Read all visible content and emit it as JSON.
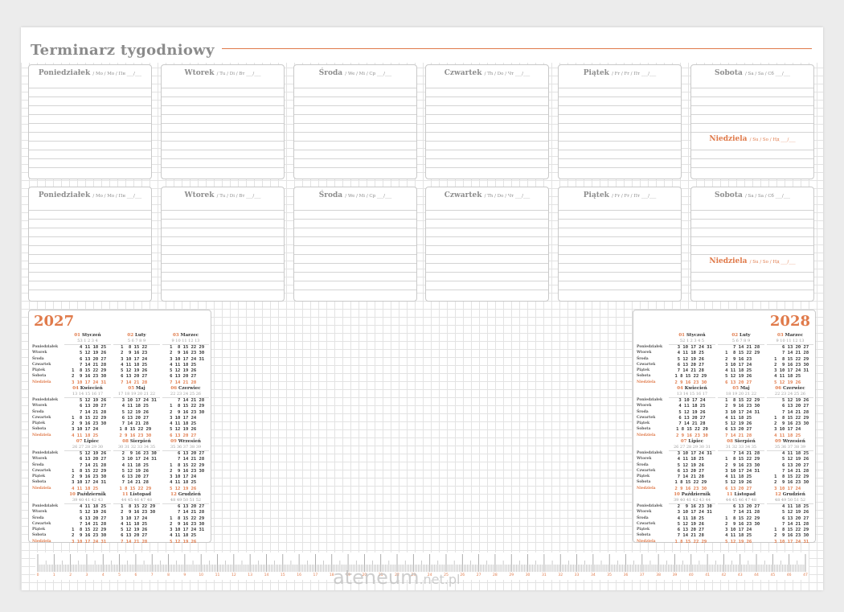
{
  "title": "Terminarz  tygodniowy",
  "colors": {
    "accent": "#e07a4a",
    "grid": "#e3e3e3",
    "text_gray": "#8b8b8b"
  },
  "week_days": [
    {
      "name": "Poniedziałek",
      "sub": "/ Mo / Mo / Пн  ___/___"
    },
    {
      "name": "Wtorek",
      "sub": "/ Tu / Di / Вт  ___/___"
    },
    {
      "name": "Środa",
      "sub": "/ We / Mi / Ср  ___/___"
    },
    {
      "name": "Czwartek",
      "sub": "/ Th / Do / Чт  ___/___"
    },
    {
      "name": "Piątek",
      "sub": "/ Fr / Fr / Пт  ___/___"
    },
    {
      "name": "Sobota",
      "sub": "/ Sa / Sa / Сб  ___/___"
    }
  ],
  "sunday": {
    "name": "Niedziela",
    "sub": "/ Su / So / Нд  ___/___"
  },
  "weekday_labels": [
    "Poniedziałek",
    "Wtorek",
    "Środa",
    "Czwartek",
    "Piątek",
    "Sobota",
    "Niedziela"
  ],
  "calendars": [
    {
      "year": "2027",
      "months": [
        {
          "num": "01",
          "name": "Styczeń",
          "weeks": "53  1  2  3  4",
          "rows": [
            "    4 11 18 25",
            "    5 12 19 26",
            "    6 13 20 27",
            "    7 14 21 28",
            " 1  8 15 22 29",
            " 2  9 16 23 30",
            " 3 10 17 24 31"
          ]
        },
        {
          "num": "02",
          "name": "Luty",
          "weeks": "5  6  7  8  9",
          "rows": [
            " 1  8 15 22   ",
            " 2  9 16 23   ",
            " 3 10 17 24   ",
            " 4 11 18 25   ",
            " 5 12 19 26   ",
            " 6 13 20 27   ",
            " 7 14 21 28   "
          ]
        },
        {
          "num": "03",
          "name": "Marzec",
          "weeks": "9 10 11 12 13",
          "rows": [
            " 1  8 15 22 29",
            " 2  9 16 23 30",
            " 3 10 17 24 31",
            " 4 11 18 25   ",
            " 5 12 19 26   ",
            " 6 13 20 27   ",
            " 7 14 21 28   "
          ]
        },
        {
          "num": "04",
          "name": "Kwiecień",
          "weeks": "13 14 15 16 17",
          "rows": [
            "    5 12 19 26",
            "    6 13 20 27",
            "    7 14 21 28",
            " 1  8 15 22 29",
            " 2  9 16 23 30",
            " 3 10 17 24   ",
            " 4 11 18 25   "
          ]
        },
        {
          "num": "05",
          "name": "Maj",
          "weeks": "17 18 19 20 21 22",
          "rows": [
            "  3 10 17 24 31",
            "  4 11 18 25   ",
            "  5 12 19 26   ",
            "  6 13 20 27   ",
            "  7 14 21 28   ",
            " 1 8 15 22 29  ",
            " 2 9 16 23 30  "
          ]
        },
        {
          "num": "06",
          "name": "Czerwiec",
          "weeks": "22 23 24 25 26",
          "rows": [
            "    7 14 21 28",
            " 1  8 15 22 29",
            " 2  9 16 23 30",
            " 3 10 17 24   ",
            " 4 11 18 25   ",
            " 5 12 19 26   ",
            " 6 13 20 27   "
          ]
        },
        {
          "num": "07",
          "name": "Lipiec",
          "weeks": "26 27 28 29 30",
          "rows": [
            "    5 12 19 26",
            "    6 13 20 27",
            "    7 14 21 28",
            " 1  8 15 22 29",
            " 2  9 16 23 30",
            " 3 10 17 24 31",
            " 4 11 18 25   "
          ]
        },
        {
          "num": "08",
          "name": "Sierpień",
          "weeks": "30 31 32 33 34 35",
          "rows": [
            "  2  9 16 23 30",
            "  3 10 17 24 31",
            "  4 11 18 25   ",
            "  5 12 19 26   ",
            "  6 13 20 27   ",
            "  7 14 21 28   ",
            " 1 8 15 22 29  "
          ]
        },
        {
          "num": "09",
          "name": "Wrzesień",
          "weeks": "35 36 37 38 39",
          "rows": [
            "    6 13 20 27",
            "    7 14 21 28",
            " 1  8 15 22 29",
            " 2  9 16 23 30",
            " 3 10 17 24   ",
            " 4 11 18 25   ",
            " 5 12 19 26   "
          ]
        },
        {
          "num": "10",
          "name": "Październik",
          "weeks": "39 40 41 42 43",
          "rows": [
            "    4 11 18 25",
            "    5 12 19 26",
            "    6 13 20 27",
            "    7 14 21 28",
            " 1  8 15 22 29",
            " 2  9 16 23 30",
            " 3 10 17 24 31"
          ]
        },
        {
          "num": "11",
          "name": "Listopad",
          "weeks": "44 45 46 47 48",
          "rows": [
            " 1  8 15 22 29",
            " 2  9 16 23 30",
            " 3 10 17 24   ",
            " 4 11 18 25   ",
            " 5 12 19 26   ",
            " 6 13 20 27   ",
            " 7 14 21 28   "
          ]
        },
        {
          "num": "12",
          "name": "Grudzień",
          "weeks": "48 49 50 51 52",
          "rows": [
            "    6 13 20 27",
            "    7 14 21 28",
            " 1  8 15 22 29",
            " 2  9 16 23 30",
            " 3 10 17 24 31",
            " 4 11 18 25   ",
            " 5 12 19 26   "
          ]
        }
      ]
    },
    {
      "year": "2028",
      "months": [
        {
          "num": "01",
          "name": "Styczeń",
          "weeks": "52  1  2  3  4  5",
          "rows": [
            "  3 10 17 24 31",
            "  4 11 18 25   ",
            "  5 12 19 26   ",
            "  6 13 20 27   ",
            "  7 14 21 28   ",
            " 1 8 15 22 29  ",
            " 2 9 16 23 30  "
          ]
        },
        {
          "num": "02",
          "name": "Luty",
          "weeks": "5  6  7  8  9",
          "rows": [
            "    7 14 21 28",
            " 1  8 15 22 29",
            " 2  9 16 23   ",
            " 3 10 17 24   ",
            " 4 11 18 25   ",
            " 5 12 19 26   ",
            " 6 13 20 27   "
          ]
        },
        {
          "num": "03",
          "name": "Marzec",
          "weeks": "9 10 11 12 13",
          "rows": [
            "    6 13 20 27",
            "    7 14 21 28",
            " 1  8 15 22 29",
            " 2  9 16 23 30",
            " 3 10 17 24 31",
            " 4 11 18 25   ",
            " 5 12 19 26   "
          ]
        },
        {
          "num": "04",
          "name": "Kwiecień",
          "weeks": "13 14 15 16 17",
          "rows": [
            "  3 10 17 24  ",
            "  4 11 18 25  ",
            "  5 12 19 26  ",
            "  6 13 20 27  ",
            "  7 14 21 28  ",
            " 1 8 15 22 29 ",
            " 2 9 16 23 30 "
          ]
        },
        {
          "num": "05",
          "name": "Maj",
          "weeks": "18 19 20 21 22",
          "rows": [
            " 1  8 15 22 29",
            " 2  9 16 23 30",
            " 3 10 17 24 31",
            " 4 11 18 25   ",
            " 5 12 19 26   ",
            " 6 13 20 27   ",
            " 7 14 21 28   "
          ]
        },
        {
          "num": "06",
          "name": "Czerwiec",
          "weeks": "22 23 24 25 26",
          "rows": [
            "    5 12 19 26",
            "    6 13 20 27",
            "    7 14 21 28",
            " 1  8 15 22 29",
            " 2  9 16 23 30",
            " 3 10 17 24   ",
            " 4 11 18 25   "
          ]
        },
        {
          "num": "07",
          "name": "Lipiec",
          "weeks": "26 27 28 29 30 31",
          "rows": [
            "  3 10 17 24 31",
            "  4 11 18 25   ",
            "  5 12 19 26   ",
            "  6 13 20 27   ",
            "  7 14 21 28   ",
            " 1 8 15 22 29  ",
            " 2 9 16 23 30  "
          ]
        },
        {
          "num": "08",
          "name": "Sierpień",
          "weeks": "31 32 33 34 35",
          "rows": [
            "    7 14 21 28",
            " 1  8 15 22 29",
            " 2  9 16 23 30",
            " 3 10 17 24 31",
            " 4 11 18 25   ",
            " 5 12 19 26   ",
            " 6 13 20 27   "
          ]
        },
        {
          "num": "09",
          "name": "Wrzesień",
          "weeks": "35 36 37 38 39",
          "rows": [
            "    4 11 18 25",
            "    5 12 19 26",
            "    6 13 20 27",
            "    7 14 21 28",
            " 1  8 15 22 29",
            " 2  9 16 23 30",
            " 3 10 17 24   "
          ]
        },
        {
          "num": "10",
          "name": "Październik",
          "weeks": "39 40 41 42 43 44",
          "rows": [
            "  2  9 16 23 30",
            "  3 10 17 24 31",
            "  4 11 18 25   ",
            "  5 12 19 26   ",
            "  6 13 20 27   ",
            "  7 14 21 28   ",
            " 1 8 15 22 29  "
          ]
        },
        {
          "num": "11",
          "name": "Listopad",
          "weeks": "44 45 46 47 48",
          "rows": [
            "    6 13 20 27",
            "    7 14 21 28",
            " 1  8 15 22 29",
            " 2  9 16 23 30",
            " 3 10 17 24   ",
            " 4 11 18 25   ",
            " 5 12 19 26   "
          ]
        },
        {
          "num": "12",
          "name": "Grudzień",
          "weeks": "48 49 50 51 52",
          "rows": [
            "    4 11 18 25",
            "    5 12 19 26",
            "    6 13 20 27",
            "    7 14 21 28",
            " 1  8 15 22 29",
            " 2  9 16 23 30",
            " 3 10 17 24 31"
          ]
        }
      ]
    }
  ],
  "ruler_numbers": [
    "0",
    "1",
    "2",
    "3",
    "4",
    "5",
    "6",
    "7",
    "8",
    "9",
    "10",
    "11",
    "12",
    "13",
    "14",
    "15",
    "16",
    "17",
    "18",
    "19",
    "20",
    "21",
    "22",
    "23",
    "24",
    "25",
    "26",
    "27",
    "28",
    "29",
    "30",
    "31",
    "32",
    "33",
    "34",
    "35",
    "36",
    "37",
    "38",
    "39",
    "40",
    "41",
    "42",
    "43",
    "44",
    "45",
    "46",
    "47"
  ],
  "watermark": {
    "main": "ateneum",
    "suffix": ".net.pl"
  }
}
